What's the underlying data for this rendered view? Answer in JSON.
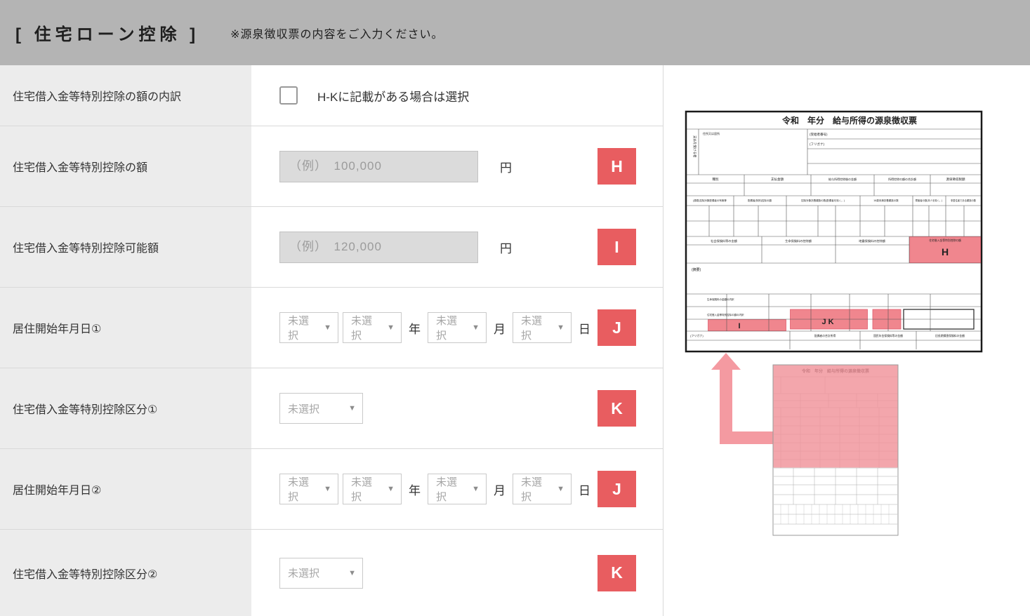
{
  "header": {
    "title": "[ 住宅ローン控除 ]",
    "note": "※源泉徴収票の内容をご入力ください。"
  },
  "form": {
    "select_placeholder": "未選択",
    "date_units": {
      "year": "年",
      "month": "月",
      "day": "日"
    },
    "rows": [
      {
        "label": "住宅借入金等特別控除の額の内訳",
        "checkbox_label": "H-Kに記載がある場合は選択"
      },
      {
        "label": "住宅借入金等特別控除の額",
        "placeholder": "（例）　100,000",
        "unit": "円",
        "badge": "H"
      },
      {
        "label": "住宅借入金等特別控除可能額",
        "placeholder": "（例）　120,000",
        "unit": "円",
        "badge": "I"
      },
      {
        "label": "居住開始年月日①",
        "badge": "J"
      },
      {
        "label": "住宅借入金等特別控除区分①",
        "badge": "K"
      },
      {
        "label": "居住開始年月日②",
        "badge": "J"
      },
      {
        "label": "住宅借入金等特別控除区分②",
        "badge": "K"
      }
    ]
  },
  "reference": {
    "doc_title": "令和　年分　給与所得の源泉徴収票",
    "markers": {
      "h": "H",
      "i": "I",
      "jk": "J K"
    },
    "labels": {
      "payee": "支払を受ける者",
      "address": "住所又は居所",
      "recipient_no": "(受給者番号)",
      "furigana": "(フリガナ)",
      "shubetsu": "種別",
      "shiharai": "支払金額",
      "kyuyo_kojo": "給与所得控除後の金額",
      "shotoku_kojo": "所得控除の額の合計額",
      "gensen_zeigaku": "源泉徴収税額",
      "haigusha_umu": "(源泉)控除対象配偶者の有無等",
      "haigusha_kojo": "配偶者(特別)控除の額",
      "fuyo": "控除対象扶養親族の数(配偶者を除く。)",
      "under16": "16歳未満扶養親族の数",
      "shogaisha": "障害者の数(本人を除く。)",
      "hikyojusha": "非居住者である親族の数",
      "shakai_hoken": "社会保険料等の金額",
      "seimei_hoken": "生命保険料の控除額",
      "jishin_hoken": "地震保険料の控除額",
      "jutaku_kojo": "住宅借入金等特別控除の額",
      "tekiyo": "(摘要)",
      "seimei_uchiwake": "生命保険料の金額の内訳",
      "jutaku_uchiwake": "住宅借入金等特別控除の額の内訳",
      "haigusha_shotoku": "配偶者の合計所得",
      "kokumin": "国民年金保険料等の金額",
      "kyuchoki": "旧長期損害保険料の金額"
    }
  }
}
